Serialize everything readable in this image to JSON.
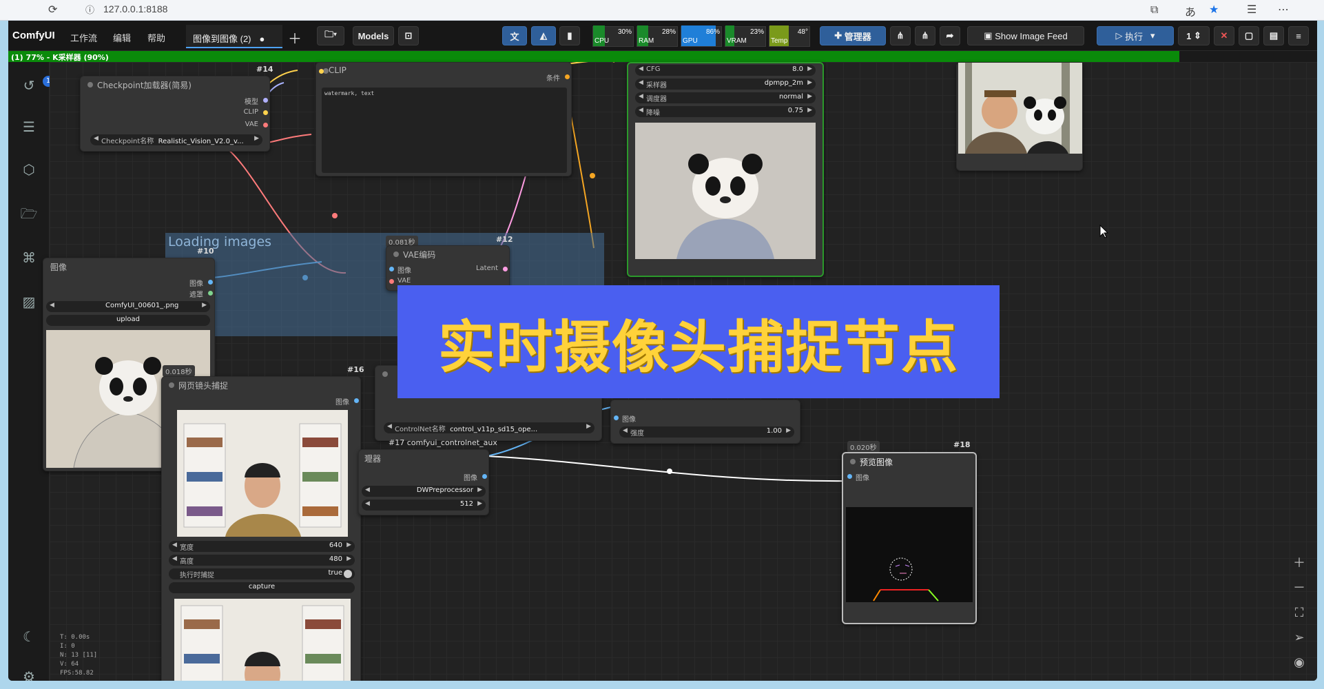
{
  "browser": {
    "url": "127.0.0.1:8188"
  },
  "menubar": {
    "brand": "ComfyUI",
    "menus": [
      "工作流",
      "编辑",
      "帮助"
    ],
    "tab_label": "图像到图像 (2)",
    "models_label": "Models",
    "cpu": {
      "label": "CPU",
      "pct": "30%"
    },
    "ram": {
      "label": "RAM",
      "pct": "28%"
    },
    "gpu": {
      "label": "GPU",
      "pct": "86%"
    },
    "vram": {
      "label": "VRAM",
      "pct": "23%"
    },
    "temp": {
      "label": "Temp",
      "pct": "48°"
    },
    "manager_label": "管理器",
    "image_feed_label": "Show Image Feed",
    "run_label": "执行",
    "queue_count": "1"
  },
  "progress": {
    "text": "(1) 77% - K采样器 (90%)",
    "fraction": 0.77
  },
  "sidebar": {
    "history_badge": "1"
  },
  "nodes": {
    "n14": {
      "id": "#14",
      "title": "Checkpoint加载器(简易)",
      "outputs": [
        "模型",
        "CLIP",
        "VAE"
      ],
      "ckpt_label": "Checkpoint名称",
      "ckpt_value": "Realistic_Vision_V2.0_v..."
    },
    "clip": {
      "title": "CLIP",
      "out": "条件",
      "text": "watermark, text"
    },
    "ksampler": {
      "cfg_label": "CFG",
      "cfg": "8.0",
      "sampler_label": "采样器",
      "sampler": "dpmpp_2m",
      "scheduler_label": "调度器",
      "scheduler": "normal",
      "denoise_label": "降噪",
      "denoise": "0.75"
    },
    "group": {
      "title": "Loading images"
    },
    "n10": {
      "id": "#10",
      "title": "图像",
      "out_image": "图像",
      "out_mask": "遮罩",
      "file": "ComfyUI_00601_.png",
      "upload": "upload"
    },
    "n12": {
      "id": "#12",
      "timing": "0.081秒",
      "title": "VAE编码",
      "in_image": "图像",
      "in_vae": "VAE",
      "out": "Latent"
    },
    "n16": {
      "id": "#16",
      "timing": "0.018秒",
      "title": "网页镜头捕捉",
      "out": "图像",
      "width_label": "宽度",
      "width": "640",
      "height_label": "高度",
      "height": "480",
      "capture_label": "执行时捕捉",
      "capture_value": "true",
      "capture_btn": "capture"
    },
    "n17": {
      "id": "#17 comfyui_controlnet_aux",
      "cn_label": "ControlNet名称",
      "cn_value": "control_v11p_sd15_ope..."
    },
    "preproc": {
      "title": "理器",
      "out": "图像",
      "pre": "DWPreprocessor",
      "res": "512"
    },
    "apply": {
      "in": "图像",
      "strength_label": "强度",
      "strength": "1.00"
    },
    "n18": {
      "id": "#18",
      "timing": "0.020秒",
      "title": "预览图像",
      "in": "图像"
    }
  },
  "banner": {
    "text": "实时摄像头捕捉节点"
  },
  "stats": {
    "t": "T: 0.00s",
    "i": "I: 0",
    "n": "N: 13 [11]",
    "v": "V: 64",
    "fps": "FPS:58.82"
  }
}
